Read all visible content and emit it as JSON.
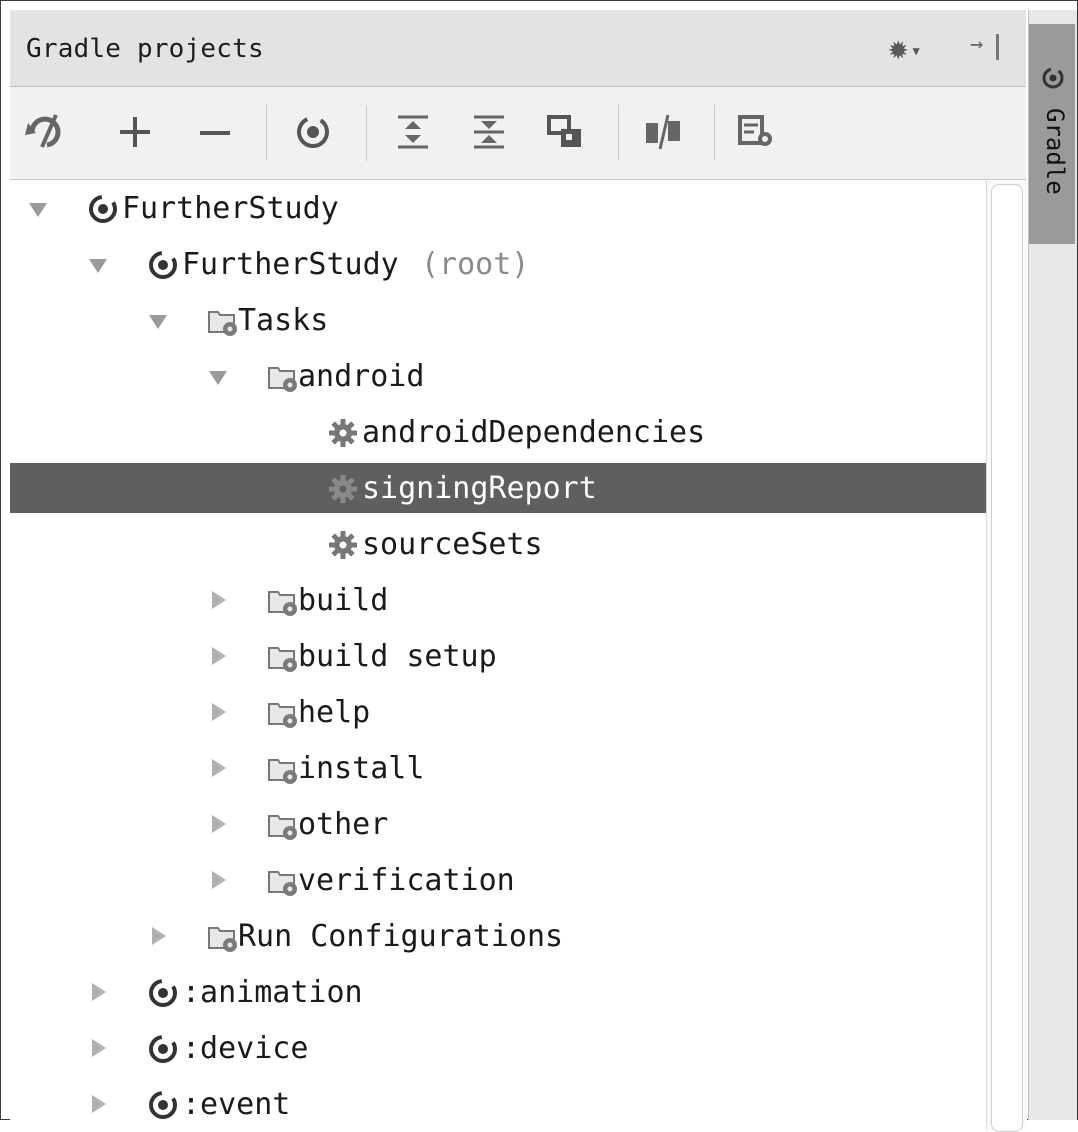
{
  "title": "Gradle projects",
  "side_tab": {
    "label": "Gradle"
  },
  "toolbar": [
    {
      "icon": "refresh-icon"
    },
    {
      "icon": "plus-icon"
    },
    {
      "icon": "minus-icon"
    },
    {
      "icon": "gradle-execute-icon"
    },
    {
      "icon": "expand-all-icon"
    },
    {
      "icon": "collapse-all-icon"
    },
    {
      "icon": "group-modules-icon"
    },
    {
      "icon": "toggle-offline-icon"
    },
    {
      "icon": "gradle-settings-icon"
    }
  ],
  "tree": [
    {
      "label": "FurtherStudy",
      "suffix": "",
      "type": "module",
      "expanded": true,
      "level": 0
    },
    {
      "label": "FurtherStudy",
      "suffix": "(root)",
      "type": "module",
      "expanded": true,
      "level": 1
    },
    {
      "label": "Tasks",
      "suffix": "",
      "type": "folder",
      "expanded": true,
      "level": 2
    },
    {
      "label": "android",
      "suffix": "",
      "type": "folder",
      "expanded": true,
      "level": 3
    },
    {
      "label": "androidDependencies",
      "suffix": "",
      "type": "task",
      "level": 4
    },
    {
      "label": "signingReport",
      "suffix": "",
      "type": "task",
      "level": 4,
      "selected": true
    },
    {
      "label": "sourceSets",
      "suffix": "",
      "type": "task",
      "level": 4
    },
    {
      "label": "build",
      "suffix": "",
      "type": "folder",
      "expanded": false,
      "level": 3
    },
    {
      "label": "build setup",
      "suffix": "",
      "type": "folder",
      "expanded": false,
      "level": 3
    },
    {
      "label": "help",
      "suffix": "",
      "type": "folder",
      "expanded": false,
      "level": 3
    },
    {
      "label": "install",
      "suffix": "",
      "type": "folder",
      "expanded": false,
      "level": 3
    },
    {
      "label": "other",
      "suffix": "",
      "type": "folder",
      "expanded": false,
      "level": 3
    },
    {
      "label": "verification",
      "suffix": "",
      "type": "folder",
      "expanded": false,
      "level": 3
    },
    {
      "label": "Run Configurations",
      "suffix": "",
      "type": "folder",
      "expanded": false,
      "level": 2
    },
    {
      "label": ":animation",
      "suffix": "",
      "type": "module",
      "expanded": false,
      "level": 1
    },
    {
      "label": ":device",
      "suffix": "",
      "type": "module",
      "expanded": false,
      "level": 1
    },
    {
      "label": ":event",
      "suffix": "",
      "type": "module",
      "expanded": false,
      "level": 1
    }
  ],
  "colors": {
    "selection": "#5f5f5f",
    "title_bar": "#e3e3e3",
    "side_tab": "#9a9a9a"
  }
}
